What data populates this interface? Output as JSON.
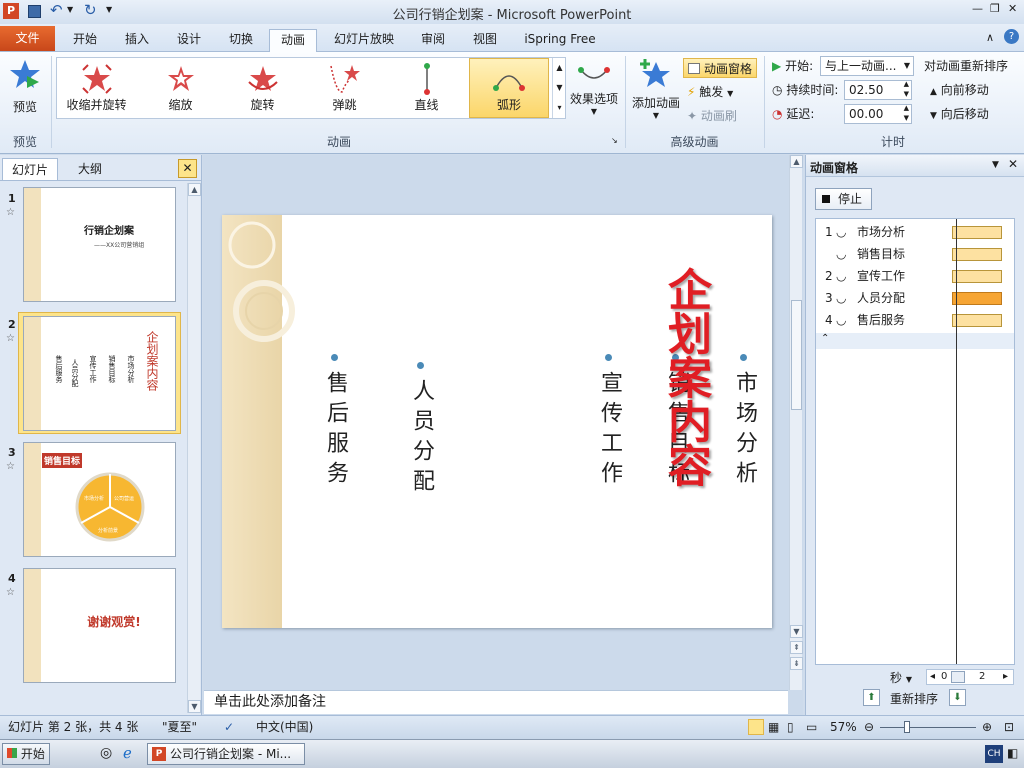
{
  "window": {
    "title": "公司行销企划案 - Microsoft PowerPoint",
    "min": "—",
    "max": "❐",
    "close": "✕"
  },
  "qat": {
    "app_letter": "P"
  },
  "tabs": [
    {
      "label": "文件",
      "active": false,
      "file": true
    },
    {
      "label": "开始"
    },
    {
      "label": "插入"
    },
    {
      "label": "设计"
    },
    {
      "label": "切换"
    },
    {
      "label": "动画",
      "active": true
    },
    {
      "label": "幻灯片放映"
    },
    {
      "label": "审阅"
    },
    {
      "label": "视图"
    },
    {
      "label": "iSpring Free"
    }
  ],
  "ribbon": {
    "preview": {
      "label": "预览",
      "group": "预览"
    },
    "gallery": [
      {
        "label": "收缩并旋转"
      },
      {
        "label": "缩放"
      },
      {
        "label": "旋转"
      },
      {
        "label": "弹跳"
      },
      {
        "label": "直线"
      },
      {
        "label": "弧形",
        "selected": true
      }
    ],
    "effect_options": "效果选项",
    "animation_group": "动画",
    "add_animation": "添加动画",
    "animation_pane_btn": "动画窗格",
    "trigger": "触发",
    "anim_painter": "动画刷",
    "advanced_group": "高级动画",
    "start_label": "开始:",
    "start_value": "与上一动画...",
    "duration_label": "持续时间:",
    "duration_value": "02.50",
    "delay_label": "延迟:",
    "delay_value": "00.00",
    "reorder_title": "对动画重新排序",
    "move_earlier": "向前移动",
    "move_later": "向后移动",
    "timing_group": "计时"
  },
  "left_panel": {
    "tab_slides": "幻灯片",
    "tab_outline": "大纲",
    "close": "✕",
    "slides": [
      {
        "num": "1",
        "title": "行销企划案",
        "subtitle": "——XX公司营销组"
      },
      {
        "num": "2"
      },
      {
        "num": "3",
        "title": "销售目标",
        "seg1": "市场分析",
        "seg2": "公司营运",
        "seg3": "分析前景"
      },
      {
        "num": "4",
        "title": "谢谢观赏!"
      }
    ],
    "slide2_items": [
      "售后服务",
      "人员分配",
      "宣传工作",
      "销售目标",
      "市场分析"
    ],
    "slide2_title": "企划案内容"
  },
  "slide": {
    "title": "企划案内容",
    "items": [
      "售后服务",
      "人员分配",
      "宣传工作",
      "销售目标",
      "市场分析"
    ]
  },
  "notes": {
    "placeholder": "单击此处添加备注"
  },
  "anim_pane": {
    "title": "动画窗格",
    "play": "停止",
    "items": [
      {
        "num": "1",
        "label": "市场分析"
      },
      {
        "num": "",
        "label": "销售目标"
      },
      {
        "num": "2",
        "label": "宣传工作"
      },
      {
        "num": "3",
        "label": "人员分配",
        "highlight": true
      },
      {
        "num": "4",
        "label": "售后服务"
      }
    ],
    "seconds": "秒",
    "timeline_start": "0",
    "timeline_end": "2",
    "reorder": "重新排序"
  },
  "status": {
    "slide_info": "幻灯片 第 2 张，共 4 张",
    "theme": "\"夏至\"",
    "language": "中文(中国)",
    "zoom": "57%"
  },
  "taskbar": {
    "start": "开始",
    "window_item": "公司行销企划案 - Mi...",
    "ime": "CH"
  },
  "colors": {
    "accent": "#c0392b",
    "file_tab": "#d4551b",
    "selected_gallery": "#fde48a",
    "dot": "#4a8ab7"
  }
}
